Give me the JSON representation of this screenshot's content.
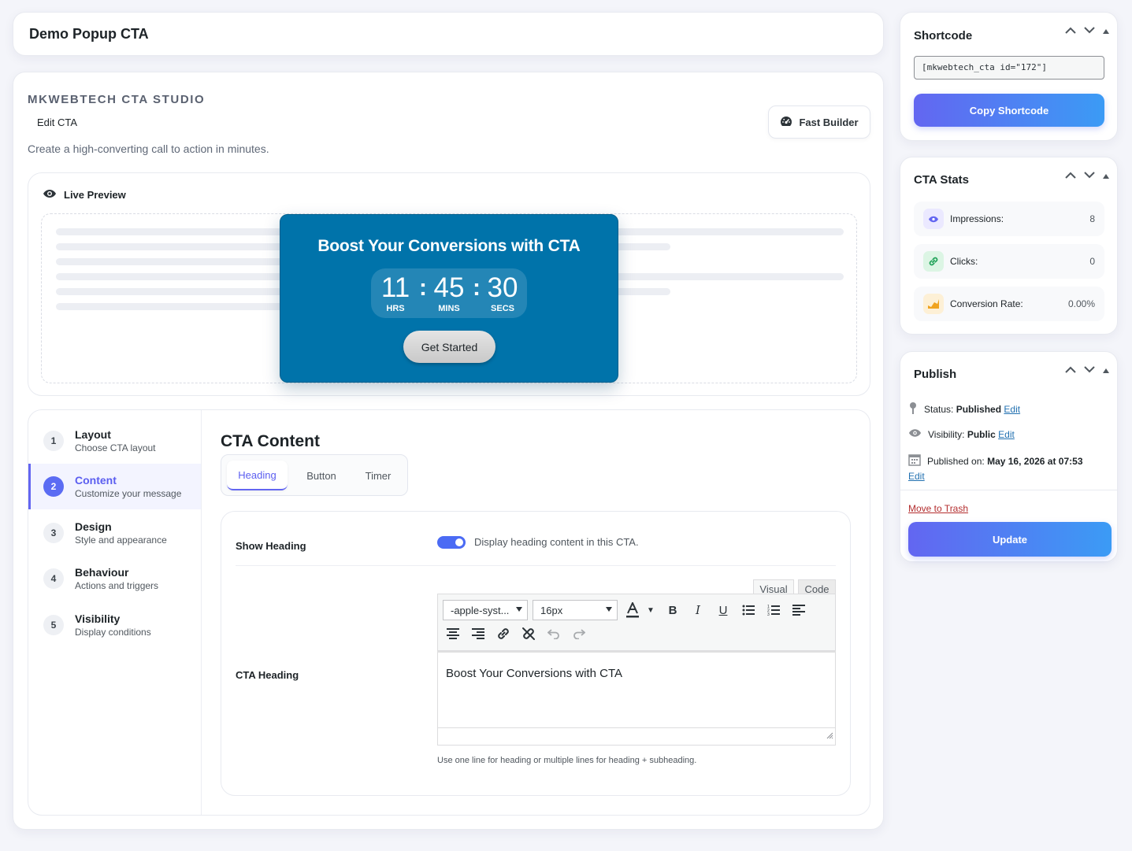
{
  "title": "Demo Popup CTA",
  "brand": "MKWEBTECH CTA STUDIO",
  "subtitle": "Edit CTA",
  "tagline": "Create a high-converting call to action in minutes.",
  "fast_builder_label": "Fast Builder",
  "preview": {
    "title": "Live Preview",
    "heading": "Boost Your Conversions with CTA",
    "timer": {
      "hours": "11",
      "hours_label": "HRS",
      "minutes": "45",
      "minutes_label": "MINS",
      "seconds": "30",
      "seconds_label": "SECS",
      "separator": ":"
    },
    "button": "Get Started",
    "popup_color": "#0073aa"
  },
  "steps": [
    {
      "num": "1",
      "title": "Layout",
      "sub": "Choose CTA layout"
    },
    {
      "num": "2",
      "title": "Content",
      "sub": "Customize your message"
    },
    {
      "num": "3",
      "title": "Design",
      "sub": "Style and appearance"
    },
    {
      "num": "4",
      "title": "Behaviour",
      "sub": "Actions and triggers"
    },
    {
      "num": "5",
      "title": "Visibility",
      "sub": "Display conditions"
    }
  ],
  "content": {
    "title": "CTA Content",
    "tabs": [
      "Heading",
      "Button",
      "Timer"
    ],
    "show_heading_label": "Show Heading",
    "show_heading_desc": "Display heading content in this CTA.",
    "show_heading_on": true,
    "heading_label": "CTA Heading",
    "editor": {
      "tab_visual": "Visual",
      "tab_code": "Code",
      "font_family": "-apple-syst...",
      "font_size": "16px",
      "value": "Boost Your Conversions with CTA"
    },
    "help": "Use one line for heading or multiple lines for heading + subheading."
  },
  "shortcode": {
    "title": "Shortcode",
    "value": "[mkwebtech_cta id=\"172\"]",
    "button": "Copy Shortcode"
  },
  "stats": {
    "title": "CTA Stats",
    "impressions_label": "Impressions:",
    "impressions": "8",
    "clicks_label": "Clicks:",
    "clicks": "0",
    "conversion_label": "Conversion Rate:",
    "conversion": "0.00%"
  },
  "publish": {
    "title": "Publish",
    "status_label": "Status:",
    "status": "Published",
    "visibility_label": "Visibility:",
    "visibility": "Public",
    "published_label": "Published on:",
    "published": "May 16, 2026 at 07:53",
    "edit": "Edit",
    "trash": "Move to Trash",
    "update": "Update"
  },
  "colors": {
    "accent": "#6366f1",
    "accent_end": "#3b9bf5",
    "popup": "#0073aa"
  }
}
